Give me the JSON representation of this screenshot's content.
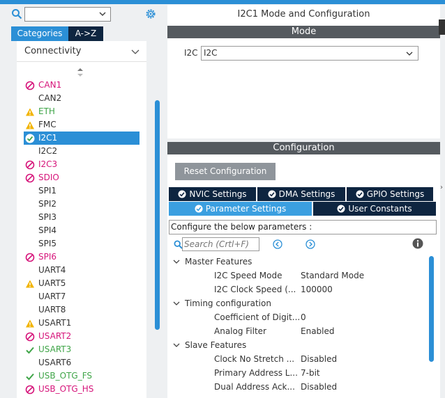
{
  "left": {
    "search_value": "",
    "tabs": [
      "Categories",
      "A->Z"
    ],
    "category": "Connectivity",
    "items": [
      {
        "label": "CAN1",
        "status": "blocked"
      },
      {
        "label": "CAN2",
        "status": "none"
      },
      {
        "label": "ETH",
        "status": "warning"
      },
      {
        "label": "FMC",
        "status": "warning"
      },
      {
        "label": "I2C1",
        "status": "ok-selected"
      },
      {
        "label": "I2C2",
        "status": "none"
      },
      {
        "label": "I2C3",
        "status": "blocked"
      },
      {
        "label": "SDIO",
        "status": "blocked"
      },
      {
        "label": "SPI1",
        "status": "none"
      },
      {
        "label": "SPI2",
        "status": "none"
      },
      {
        "label": "SPI3",
        "status": "none"
      },
      {
        "label": "SPI4",
        "status": "none"
      },
      {
        "label": "SPI5",
        "status": "none"
      },
      {
        "label": "SPI6",
        "status": "blocked"
      },
      {
        "label": "UART4",
        "status": "none"
      },
      {
        "label": "UART5",
        "status": "warning"
      },
      {
        "label": "UART7",
        "status": "none"
      },
      {
        "label": "UART8",
        "status": "none"
      },
      {
        "label": "USART1",
        "status": "warning"
      },
      {
        "label": "USART2",
        "status": "blocked"
      },
      {
        "label": "USART3",
        "status": "ok"
      },
      {
        "label": "USART6",
        "status": "none"
      },
      {
        "label": "USB_OTG_FS",
        "status": "ok"
      },
      {
        "label": "USB_OTG_HS",
        "status": "blocked"
      }
    ]
  },
  "right": {
    "title": "I2C1 Mode and Configuration",
    "mode_header": "Mode",
    "i2c_label": "I2C",
    "i2c_value": "I2C",
    "config_header": "Configuration",
    "reset_label": "Reset Configuration",
    "tabs_row1": [
      "NVIC Settings",
      "DMA Settings",
      "GPIO Settings"
    ],
    "tabs_row2": [
      "Parameter Settings",
      "User Constants"
    ],
    "info_text": "Configure the below parameters :",
    "search_placeholder": "Search (Crtl+F)",
    "tree": [
      {
        "type": "group",
        "name": "Master Features"
      },
      {
        "type": "param",
        "name": "I2C Speed Mode",
        "value": "Standard Mode"
      },
      {
        "type": "param",
        "name": "I2C Clock Speed (...",
        "value": "100000"
      },
      {
        "type": "group",
        "name": "Timing configuration"
      },
      {
        "type": "param",
        "name": "Coefficient of Digit...",
        "value": "0"
      },
      {
        "type": "param",
        "name": "Analog Filter",
        "value": "Enabled"
      },
      {
        "type": "group",
        "name": "Slave Features"
      },
      {
        "type": "param",
        "name": "Clock No Stretch ...",
        "value": "Disabled"
      },
      {
        "type": "param",
        "name": "Primary Address L...",
        "value": "7-bit"
      },
      {
        "type": "param",
        "name": "Dual Address Ack...",
        "value": "Disabled"
      }
    ]
  },
  "colors": {
    "accent": "#2b8fd6",
    "navy": "#0e2540",
    "blocked": "#d6147a",
    "ok": "#3fa548",
    "warning": "#f2b400"
  }
}
